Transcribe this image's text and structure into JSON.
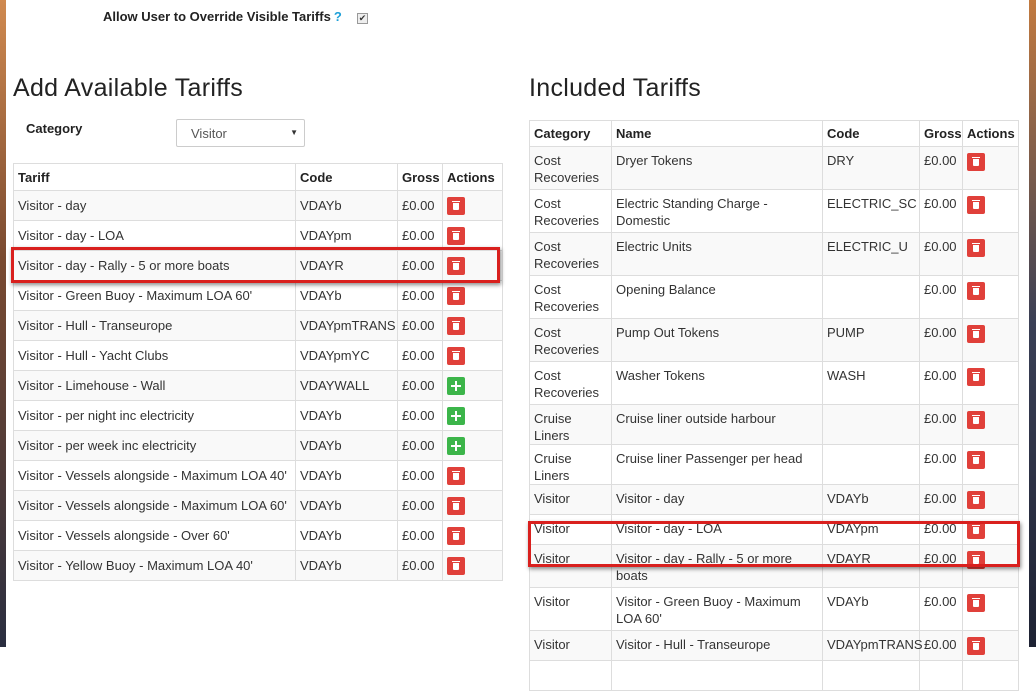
{
  "override": {
    "label": "Allow User to Override Visible Tariffs",
    "help": "?",
    "checked": true
  },
  "left": {
    "title": "Add Available Tariffs",
    "category_label": "Category",
    "category_value": "Visitor",
    "headers": [
      "Tariff",
      "Code",
      "Gross",
      "Actions"
    ],
    "rows": [
      {
        "tariff": "Visitor - day",
        "code": "VDAYb",
        "gross": "£0.00",
        "action": "delete"
      },
      {
        "tariff": "Visitor - day - LOA",
        "code": "VDAYpm",
        "gross": "£0.00",
        "action": "delete"
      },
      {
        "tariff": "Visitor - day - Rally - 5 or more boats",
        "code": "VDAYR",
        "gross": "£0.00",
        "action": "delete"
      },
      {
        "tariff": "Visitor - Green Buoy - Maximum LOA 60'",
        "code": "VDAYb",
        "gross": "£0.00",
        "action": "delete"
      },
      {
        "tariff": "Visitor - Hull - Transeurope",
        "code": "VDAYpmTRANS",
        "gross": "£0.00",
        "action": "delete"
      },
      {
        "tariff": "Visitor - Hull - Yacht Clubs",
        "code": "VDAYpmYC",
        "gross": "£0.00",
        "action": "delete"
      },
      {
        "tariff": "Visitor - Limehouse - Wall",
        "code": "VDAYWALL",
        "gross": "£0.00",
        "action": "add"
      },
      {
        "tariff": "Visitor - per night inc electricity",
        "code": "VDAYb",
        "gross": "£0.00",
        "action": "add"
      },
      {
        "tariff": "Visitor - per week inc electricity",
        "code": "VDAYb",
        "gross": "£0.00",
        "action": "add"
      },
      {
        "tariff": "Visitor - Vessels alongside - Maximum LOA 40'",
        "code": "VDAYb",
        "gross": "£0.00",
        "action": "delete"
      },
      {
        "tariff": "Visitor - Vessels alongside - Maximum LOA 60'",
        "code": "VDAYb",
        "gross": "£0.00",
        "action": "delete"
      },
      {
        "tariff": "Visitor - Vessels alongside - Over 60'",
        "code": "VDAYb",
        "gross": "£0.00",
        "action": "delete"
      },
      {
        "tariff": "Visitor - Yellow Buoy - Maximum LOA 40'",
        "code": "VDAYb",
        "gross": "£0.00",
        "action": "delete"
      }
    ]
  },
  "right": {
    "title": "Included Tariffs",
    "headers": [
      "Category",
      "Name",
      "Code",
      "Gross",
      "Actions"
    ],
    "rows": [
      {
        "category": "Cost Recoveries",
        "name": "Dryer Tokens",
        "code": "DRY",
        "gross": "£0.00"
      },
      {
        "category": "Cost Recoveries",
        "name": "Electric Standing Charge - Domestic",
        "code": "ELECTRIC_SC",
        "gross": "£0.00"
      },
      {
        "category": "Cost Recoveries",
        "name": "Electric Units",
        "code": "ELECTRIC_U",
        "gross": "£0.00"
      },
      {
        "category": "Cost Recoveries",
        "name": "Opening Balance",
        "code": "",
        "gross": "£0.00"
      },
      {
        "category": "Cost Recoveries",
        "name": "Pump Out Tokens",
        "code": "PUMP",
        "gross": "£0.00"
      },
      {
        "category": "Cost Recoveries",
        "name": "Washer Tokens",
        "code": "WASH",
        "gross": "£0.00"
      },
      {
        "category": "Cruise Liners",
        "name": "Cruise liner outside harbour",
        "code": "",
        "gross": "£0.00"
      },
      {
        "category": "Cruise Liners",
        "name": "Cruise liner Passenger per head",
        "code": "",
        "gross": "£0.00"
      },
      {
        "category": "Visitor",
        "name": "Visitor - day",
        "code": "VDAYb",
        "gross": "£0.00"
      },
      {
        "category": "Visitor",
        "name": "Visitor - day - LOA",
        "code": "VDAYpm",
        "gross": "£0.00"
      },
      {
        "category": "Visitor",
        "name": "Visitor - day - Rally - 5 or more boats",
        "code": "VDAYR",
        "gross": "£0.00"
      },
      {
        "category": "Visitor",
        "name": "Visitor - Green Buoy - Maximum LOA 60'",
        "code": "VDAYb",
        "gross": "£0.00"
      },
      {
        "category": "Visitor",
        "name": "Visitor - Hull - Transeurope",
        "code": "VDAYpmTRANS",
        "gross": "£0.00"
      },
      {
        "category": "",
        "name": "",
        "code": "",
        "gross": ""
      }
    ]
  }
}
